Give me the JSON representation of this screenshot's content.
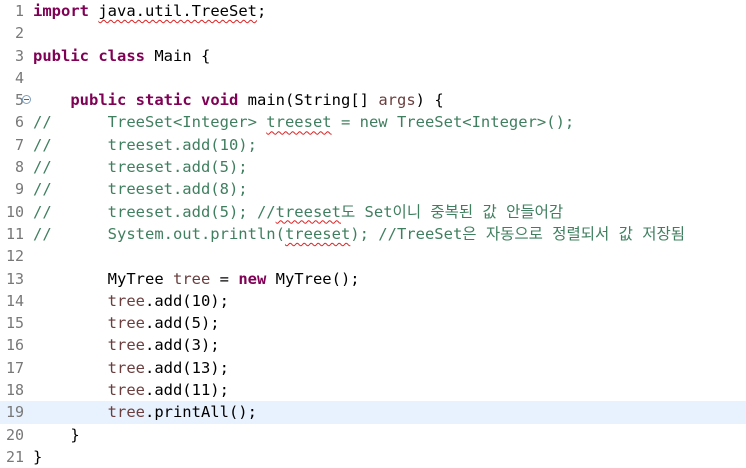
{
  "editor": {
    "lines": [
      {
        "num": "1",
        "segs": [
          {
            "t": "import",
            "c": "kw"
          },
          {
            "t": " "
          },
          {
            "t": "java.util.TreeSet",
            "c": "squig"
          },
          {
            "t": ";"
          }
        ]
      },
      {
        "num": "2",
        "segs": []
      },
      {
        "num": "3",
        "segs": [
          {
            "t": "public",
            "c": "kw"
          },
          {
            "t": " "
          },
          {
            "t": "class",
            "c": "kw"
          },
          {
            "t": " Main {"
          }
        ]
      },
      {
        "num": "4",
        "segs": []
      },
      {
        "num": "5",
        "fold": true,
        "segs": [
          {
            "t": "    "
          },
          {
            "t": "public",
            "c": "kw"
          },
          {
            "t": " "
          },
          {
            "t": "static",
            "c": "kw"
          },
          {
            "t": " "
          },
          {
            "t": "void",
            "c": "kw"
          },
          {
            "t": " main(String[] "
          },
          {
            "t": "args",
            "c": "var"
          },
          {
            "t": ") {"
          }
        ]
      },
      {
        "num": "6",
        "segs": [
          {
            "t": "//      TreeSet<Integer> ",
            "c": "cm"
          },
          {
            "t": "treeset",
            "c": "cm squig"
          },
          {
            "t": " = new TreeSet<Integer>();",
            "c": "cm"
          }
        ]
      },
      {
        "num": "7",
        "segs": [
          {
            "t": "//      treeset.add(10);",
            "c": "cm"
          }
        ]
      },
      {
        "num": "8",
        "segs": [
          {
            "t": "//      treeset.add(5);",
            "c": "cm"
          }
        ]
      },
      {
        "num": "9",
        "segs": [
          {
            "t": "//      treeset.add(8);",
            "c": "cm"
          }
        ]
      },
      {
        "num": "10",
        "segs": [
          {
            "t": "//      treeset.add(5); //",
            "c": "cm"
          },
          {
            "t": "treeset",
            "c": "cm squig"
          },
          {
            "t": "도 Set이니 중복된 값 안들어감",
            "c": "cm"
          }
        ]
      },
      {
        "num": "11",
        "segs": [
          {
            "t": "//      System.out.println(",
            "c": "cm"
          },
          {
            "t": "treeset",
            "c": "cm squig"
          },
          {
            "t": "); //TreeSet은 자동으로 정렬되서 값 저장됨",
            "c": "cm"
          }
        ]
      },
      {
        "num": "12",
        "segs": []
      },
      {
        "num": "13",
        "segs": [
          {
            "t": "        MyTree "
          },
          {
            "t": "tree",
            "c": "var"
          },
          {
            "t": " = "
          },
          {
            "t": "new",
            "c": "kw"
          },
          {
            "t": " MyTree();"
          }
        ]
      },
      {
        "num": "14",
        "segs": [
          {
            "t": "        "
          },
          {
            "t": "tree",
            "c": "var"
          },
          {
            "t": ".add(10);"
          }
        ]
      },
      {
        "num": "15",
        "segs": [
          {
            "t": "        "
          },
          {
            "t": "tree",
            "c": "var"
          },
          {
            "t": ".add(5);"
          }
        ]
      },
      {
        "num": "16",
        "segs": [
          {
            "t": "        "
          },
          {
            "t": "tree",
            "c": "var"
          },
          {
            "t": ".add(3);"
          }
        ]
      },
      {
        "num": "17",
        "segs": [
          {
            "t": "        "
          },
          {
            "t": "tree",
            "c": "var"
          },
          {
            "t": ".add(13);"
          }
        ]
      },
      {
        "num": "18",
        "segs": [
          {
            "t": "        "
          },
          {
            "t": "tree",
            "c": "var"
          },
          {
            "t": ".add(11);"
          }
        ]
      },
      {
        "num": "19",
        "current": true,
        "segs": [
          {
            "t": "        "
          },
          {
            "t": "tree",
            "c": "var"
          },
          {
            "t": ".printAll();"
          }
        ]
      },
      {
        "num": "20",
        "segs": [
          {
            "t": "    }"
          }
        ]
      },
      {
        "num": "21",
        "segs": [
          {
            "t": "}"
          }
        ]
      }
    ]
  }
}
